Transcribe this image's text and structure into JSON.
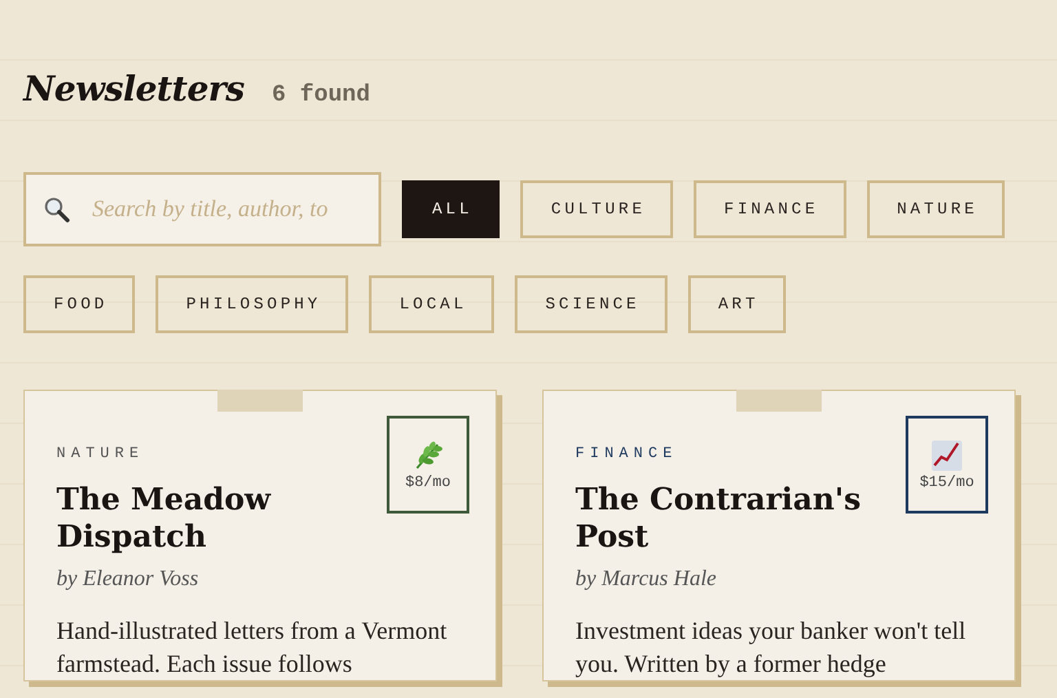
{
  "header": {
    "title": "Newsletters",
    "count": "6 found"
  },
  "search": {
    "placeholder": "Search by title, author, to"
  },
  "filters": [
    {
      "label": "ALL",
      "selected": true
    },
    {
      "label": "CULTURE",
      "selected": false
    },
    {
      "label": "FINANCE",
      "selected": false
    },
    {
      "label": "NATURE",
      "selected": false
    },
    {
      "label": "FOOD",
      "selected": false
    },
    {
      "label": "PHILOSOPHY",
      "selected": false
    },
    {
      "label": "LOCAL",
      "selected": false
    },
    {
      "label": "SCIENCE",
      "selected": false
    },
    {
      "label": "ART",
      "selected": false
    }
  ],
  "cards": [
    {
      "category": "NATURE",
      "title": "The Meadow Dispatch",
      "author": "by Eleanor Voss",
      "price": "$8/mo",
      "kind": "leaf",
      "color": "#3f5a3a",
      "description": "Hand-illustrated letters from a Vermont farmstead. Each issue follows"
    },
    {
      "category": "FINANCE",
      "title": "The Contrarian's Post",
      "author": "by Marcus Hale",
      "price": "$15/mo",
      "kind": "chart",
      "color": "#1f3a5f",
      "description": "Investment ideas your banker won't tell you. Written by a former hedge"
    }
  ]
}
